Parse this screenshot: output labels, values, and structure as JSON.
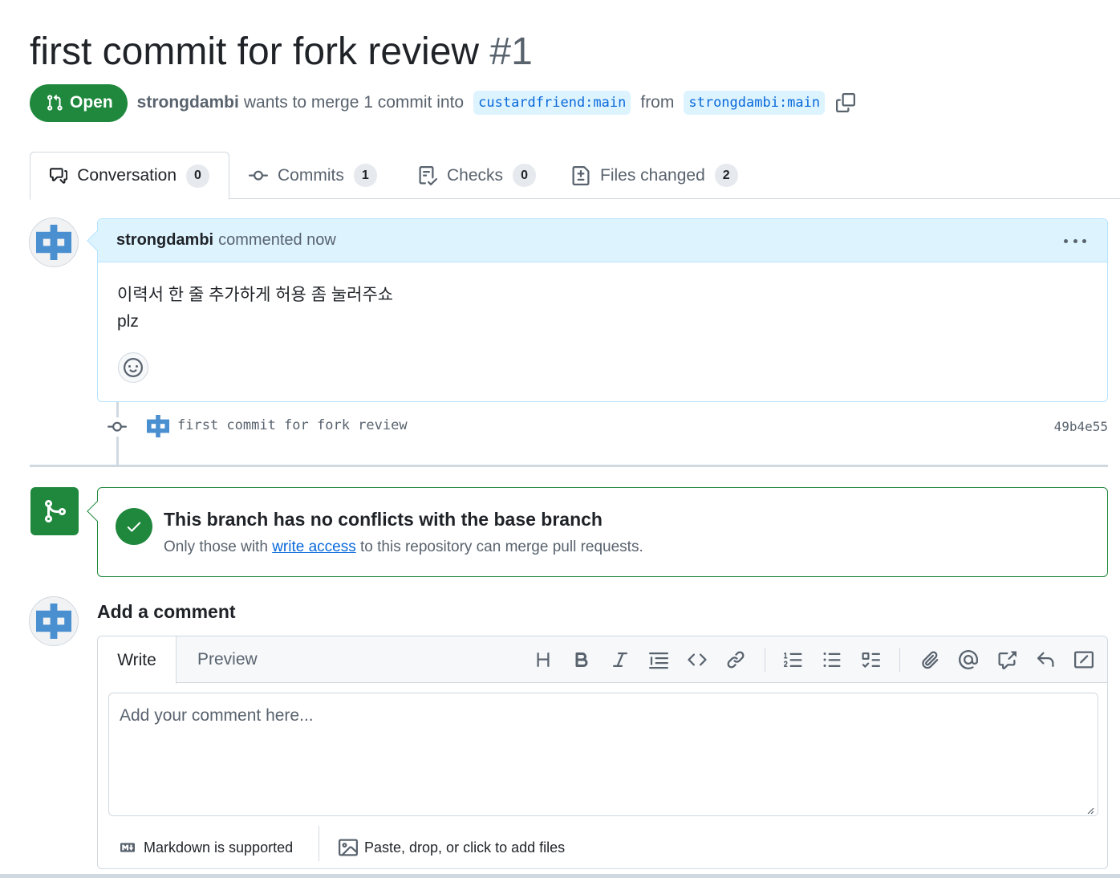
{
  "pr": {
    "title": "first commit for fork review",
    "number": "#1",
    "state": "Open",
    "author": "strongdambi",
    "merge_text": "wants to merge 1 commit into",
    "base_branch": "custardfriend:main",
    "from_text": "from",
    "head_branch": "strongdambi:main"
  },
  "tabs": [
    {
      "label": "Conversation",
      "count": "0",
      "icon": "comment-discussion-icon"
    },
    {
      "label": "Commits",
      "count": "1",
      "icon": "git-commit-icon"
    },
    {
      "label": "Checks",
      "count": "0",
      "icon": "checklist-icon"
    },
    {
      "label": "Files changed",
      "count": "2",
      "icon": "file-diff-icon"
    }
  ],
  "comment": {
    "author": "strongdambi",
    "meta": "commented now",
    "body_line1": "이력서 한 줄 추가하게 허용 좀 눌러주쇼",
    "body_line2": "plz"
  },
  "commit": {
    "message": "first commit for fork review",
    "sha": "49b4e55"
  },
  "merge": {
    "title": "This branch has no conflicts with the base branch",
    "sub_before": "Only those with",
    "sub_link": "write access",
    "sub_after": "to this repository can merge pull requests."
  },
  "add_comment": {
    "title": "Add a comment",
    "write_tab": "Write",
    "preview_tab": "Preview",
    "placeholder": "Add your comment here...",
    "markdown_note": "Markdown is supported",
    "files_note": "Paste, drop, or click to add files"
  },
  "colors": {
    "open_green": "#1f883d",
    "link_blue": "#0969da",
    "header_blue": "#ddf4ff",
    "avatar_blue": "#4a8fd0"
  }
}
